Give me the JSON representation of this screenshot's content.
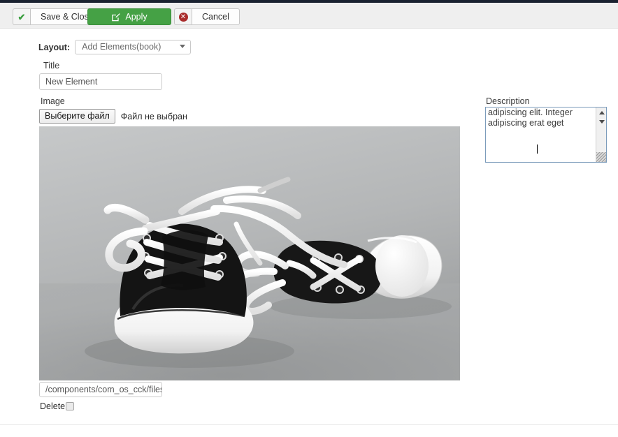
{
  "toolbar": {
    "save_close_label": "Save & Close",
    "save_close_icon": "check-icon",
    "apply_label": "Apply",
    "apply_icon": "pencil-square-icon",
    "apply_color": "#45a145",
    "cancel_label": "Cancel",
    "cancel_icon": "error-circle-icon",
    "cancel_icon_color": "#a92c2c"
  },
  "form": {
    "layout": {
      "label": "Layout:",
      "selected": "Add Elements(book)",
      "caret_icon": "chevron-down-icon"
    },
    "title": {
      "label": "Title",
      "value": "New Element"
    },
    "image": {
      "label": "Image",
      "choose_button": "Выберите файл",
      "status": "Файл не выбран",
      "alt": "Black and white photograph of a pair of black canvas sneakers with white laces and white rubber toe caps",
      "path_value": "/components/com_os_cck/files/image"
    },
    "delete": {
      "label": "Delete",
      "checked": false
    },
    "description": {
      "label": "Description",
      "value": "ipsum isn't anything embarrassing.tetur adipiscing elit. Integer adipiscing erat eget",
      "scrollbar_up_icon": "triangle-up-icon",
      "scrollbar_down_icon": "triangle-down-icon",
      "resize_icon": "resize-grip-icon"
    }
  }
}
